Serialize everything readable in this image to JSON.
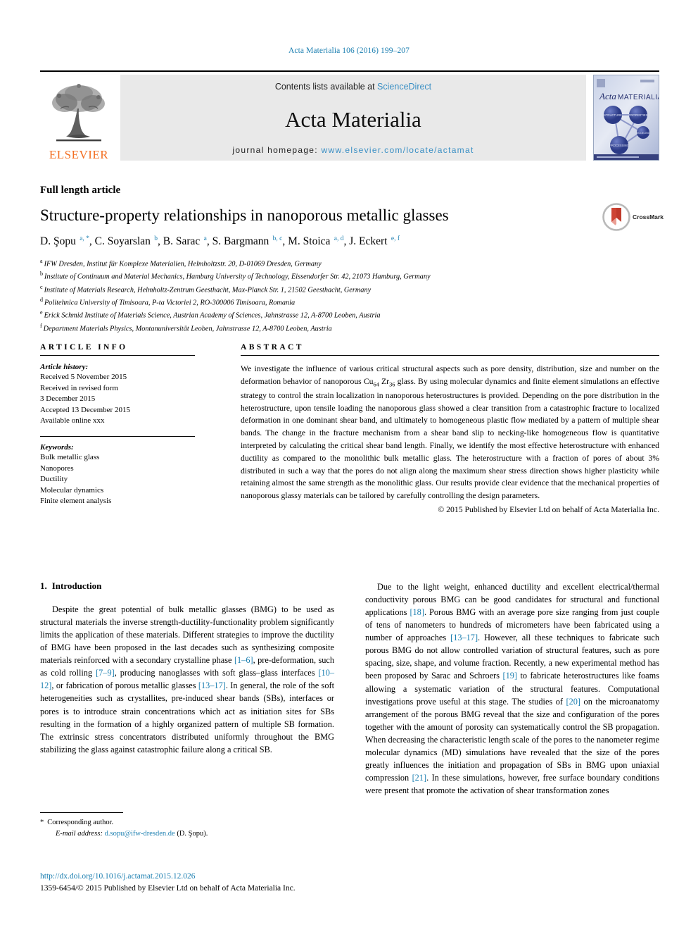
{
  "running_head": "Acta Materialia 106 (2016) 199–207",
  "masthead": {
    "contents_prefix": "Contents lists available at ",
    "sciencedirect": "ScienceDirect",
    "journal_name": "Acta Materialia",
    "homepage_prefix": "journal homepage: ",
    "homepage_url": "www.elsevier.com/locate/actamat",
    "elsevier_wordmark": "ELSEVIER",
    "cover": {
      "title_italic": "Acta",
      "title_rest": "MATERIALIA",
      "node_labels": [
        "STRUCTURE",
        "PROPERTIES",
        "MODELING",
        "PROCESSING"
      ]
    },
    "colors": {
      "link": "#3a8fc4",
      "band_bg": "#e9e9e9",
      "elsevier_orange": "#F36E21",
      "cover_blue": "#3b4b9c"
    }
  },
  "article": {
    "kicker": "Full length article",
    "title": "Structure-property relationships in nanoporous metallic glasses",
    "crossmark_label": "CrossMark",
    "authors": [
      {
        "name": "D. Şopu",
        "sups": "a, *"
      },
      {
        "name": "C. Soyarslan",
        "sups": "b"
      },
      {
        "name": "B. Sarac",
        "sups": "a"
      },
      {
        "name": "S. Bargmann",
        "sups": "b, c"
      },
      {
        "name": "M. Stoica",
        "sups": "a, d"
      },
      {
        "name": "J. Eckert",
        "sups": "e, f"
      }
    ],
    "affiliations": [
      {
        "mark": "a",
        "text": "IFW Dresden, Institut für Komplexe Materialien, Helmholtzstr. 20, D-01069 Dresden, Germany"
      },
      {
        "mark": "b",
        "text": "Institute of Continuum and Material Mechanics, Hamburg University of Technology, Eissendorfer Str. 42, 21073 Hamburg, Germany"
      },
      {
        "mark": "c",
        "text": "Institute of Materials Research, Helmholtz-Zentrum Geesthacht, Max-Planck Str. 1, 21502 Geesthacht, Germany"
      },
      {
        "mark": "d",
        "text": "Politehnica University of Timisoara, P-ta Victoriei 2, RO-300006 Timisoara, Romania"
      },
      {
        "mark": "e",
        "text": "Erick Schmid Institute of Materials Science, Austrian Academy of Sciences, Jahnstrasse 12, A-8700 Leoben, Austria"
      },
      {
        "mark": "f",
        "text": "Department Materials Physics, Montanuniversität Leoben, Jahnstrasse 12, A-8700 Leoben, Austria"
      }
    ]
  },
  "info": {
    "heading": "ARTICLE INFO",
    "history_title": "Article history:",
    "history": [
      "Received 5 November 2015",
      "Received in revised form",
      "3 December 2015",
      "Accepted 13 December 2015",
      "Available online xxx"
    ],
    "keywords_title": "Keywords:",
    "keywords": [
      "Bulk metallic glass",
      "Nanopores",
      "Ductility",
      "Molecular dynamics",
      "Finite element analysis"
    ]
  },
  "abstract": {
    "heading": "ABSTRACT",
    "part1": "We investigate the influence of various critical structural aspects such as pore density, distribution, size and number on the deformation behavior of nanoporous Cu",
    "sub1": "64",
    "part2": " Zr",
    "sub2": "36",
    "part3": " glass. By using molecular dynamics and finite element simulations an effective strategy to control the strain localization in nanoporous heterostructures is provided. Depending on the pore distribution in the heterostructure, upon tensile loading the nanoporous glass showed a clear transition from a catastrophic fracture to localized deformation in one dominant shear band, and ultimately to homogeneous plastic flow mediated by a pattern of multiple shear bands. The change in the fracture mechanism from a shear band slip to necking-like homogeneous flow is quantitative interpreted by calculating the critical shear band length. Finally, we identify the most effective heterostructure with enhanced ductility as compared to the monolithic bulk metallic glass. The heterostructure with a fraction of pores of about 3% distributed in such a way that the pores do not align along the maximum shear stress direction shows higher plasticity while retaining almost the same strength as the monolithic glass. Our results provide clear evidence that the mechanical properties of nanoporous glassy materials can be tailored by carefully controlling the design parameters.",
    "copyright": "© 2015 Published by Elsevier Ltd on behalf of Acta Materialia Inc."
  },
  "body": {
    "section_number": "1.",
    "section_title": "Introduction",
    "left_para_a": "Despite the great potential of bulk metallic glasses (BMG) to be used as structural materials the inverse strength-ductility-functionality problem significantly limits the application of these materials. Different strategies to improve the ductility of BMG have been proposed in the last decades such as synthesizing composite materials reinforced with a secondary crystalline phase ",
    "left_ref_1": "[1–6]",
    "left_para_b": ", pre-deformation, such as cold rolling ",
    "left_ref_2": "[7–9]",
    "left_para_c": ", producing nanoglasses with soft glass–glass interfaces ",
    "left_ref_3": "[10–12]",
    "left_para_d": ", or fabrication of porous metallic glasses ",
    "left_ref_4": "[13–17]",
    "left_para_e": ". In general, the role of the soft heterogeneities such as crystallites, pre-induced shear bands (SBs), interfaces or pores is to introduce strain concentrations which act as initiation sites for SBs resulting in the formation of a highly organized pattern of multiple SB formation. The extrinsic stress concentrators distributed uniformly throughout the BMG stabilizing the glass against catastrophic failure along a critical SB.",
    "right_para_a": "Due to the light weight, enhanced ductility and excellent electrical/thermal conductivity porous BMG can be good candidates for structural and functional applications ",
    "right_ref_1": "[18]",
    "right_para_b": ". Porous BMG with an average pore size ranging from just couple of tens of nanometers to hundreds of micrometers have been fabricated using a number of approaches ",
    "right_ref_2": "[13–17]",
    "right_para_c": ". However, all these techniques to fabricate such porous BMG do not allow controlled variation of structural features, such as pore spacing, size, shape, and volume fraction. Recently, a new experimental method has been proposed by Sarac and Schroers ",
    "right_ref_3": "[19]",
    "right_para_d": " to fabricate heterostructures like foams allowing a systematic variation of the structural features. Computational investigations prove useful at this stage. The studies of ",
    "right_ref_4": "[20]",
    "right_para_e": " on the microanatomy arrangement of the porous BMG reveal that the size and configuration of the pores together with the amount of porosity can systematically control the SB propagation. When decreasing the characteristic length scale of the pores to the nanometer regime molecular dynamics (MD) simulations have revealed that the size of the pores greatly influences the initiation and propagation of SBs in BMG upon uniaxial compression ",
    "right_ref_5": "[21]",
    "right_para_f": ". In these simulations, however, free surface boundary conditions were present that promote the activation of shear transformation zones"
  },
  "footnote": {
    "star": "*",
    "corresponding": "Corresponding author.",
    "email_label": "E-mail address:",
    "email": "d.sopu@ifw-dresden.de",
    "email_suffix": "(D. Şopu)."
  },
  "footer": {
    "doi": "http://dx.doi.org/10.1016/j.actamat.2015.12.026",
    "issn": "1359-6454/© 2015 Published by Elsevier Ltd on behalf of Acta Materialia Inc."
  }
}
